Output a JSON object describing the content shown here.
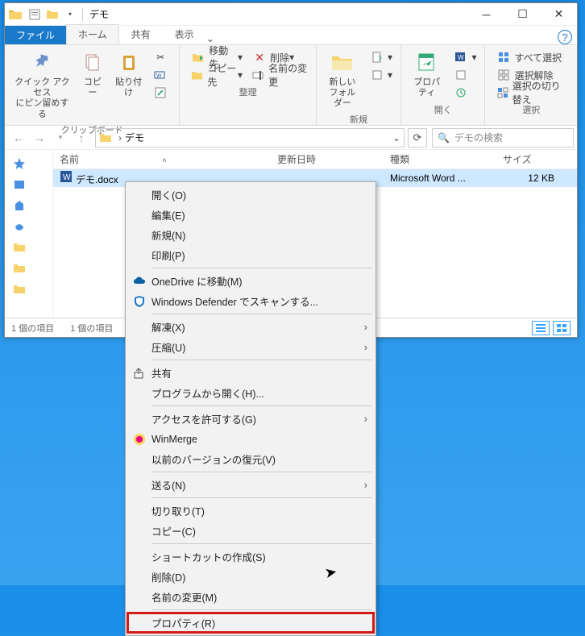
{
  "window": {
    "title": "デモ",
    "tabs": {
      "file": "ファイル",
      "home": "ホーム",
      "share": "共有",
      "view": "表示"
    },
    "help_tooltip": "?"
  },
  "ribbon": {
    "clipboard": {
      "pin": "クイック アクセス\nにピン留めする",
      "copy": "コピー",
      "paste": "貼り付け",
      "label": "クリップボード"
    },
    "organize": {
      "moveto": "移動先",
      "delete": "削除",
      "copyto": "コピー先",
      "rename": "名前の変更",
      "label": "整理"
    },
    "new": {
      "newfolder": "新しい\nフォルダー",
      "label": "新規"
    },
    "open": {
      "properties": "プロパティ",
      "label": "開く"
    },
    "select": {
      "selectall": "すべて選択",
      "selectnone": "選択解除",
      "invert": "選択の切り替え",
      "label": "選択"
    }
  },
  "address": {
    "path": "デモ",
    "search_placeholder": "デモの検索"
  },
  "columns": {
    "name": "名前",
    "modified": "更新日時",
    "type": "種類",
    "size": "サイズ"
  },
  "files": [
    {
      "name": "デモ.docx",
      "type": "Microsoft Word ...",
      "size": "12 KB"
    }
  ],
  "status": {
    "left": "1 個の項目",
    "right": "1 個の項目"
  },
  "context_menu": [
    {
      "label": "開く(O)"
    },
    {
      "label": "編集(E)"
    },
    {
      "label": "新規(N)"
    },
    {
      "label": "印刷(P)"
    },
    {
      "sep": true
    },
    {
      "label": "OneDrive に移動(M)",
      "icon": "onedrive"
    },
    {
      "label": "Windows Defender でスキャンする...",
      "icon": "defender"
    },
    {
      "sep": true
    },
    {
      "label": "解凍(X)",
      "arrow": true
    },
    {
      "label": "圧縮(U)",
      "arrow": true
    },
    {
      "sep": true
    },
    {
      "label": "共有",
      "icon": "share"
    },
    {
      "label": "プログラムから開く(H)..."
    },
    {
      "sep": true
    },
    {
      "label": "アクセスを許可する(G)",
      "arrow": true
    },
    {
      "label": "WinMerge",
      "icon": "winmerge"
    },
    {
      "label": "以前のバージョンの復元(V)"
    },
    {
      "sep": true
    },
    {
      "label": "送る(N)",
      "arrow": true
    },
    {
      "sep": true
    },
    {
      "label": "切り取り(T)"
    },
    {
      "label": "コピー(C)"
    },
    {
      "sep": true
    },
    {
      "label": "ショートカットの作成(S)"
    },
    {
      "label": "削除(D)"
    },
    {
      "label": "名前の変更(M)"
    },
    {
      "sep": true
    },
    {
      "label": "プロパティ(R)",
      "highlight": true
    }
  ]
}
